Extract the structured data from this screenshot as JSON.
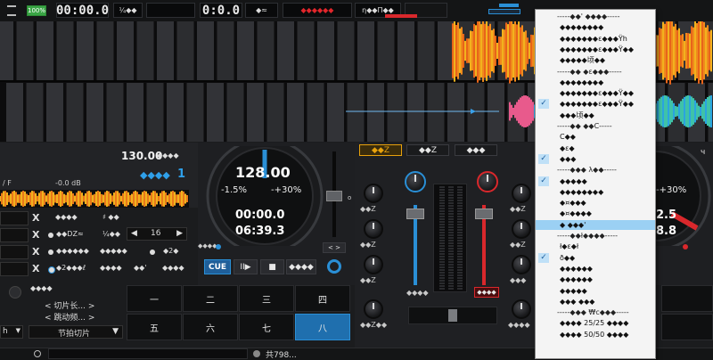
{
  "topbar": {
    "percent_badge": "100%",
    "left_time": "00:00.0",
    "small_btn": "¼◆◆",
    "center_time": "0:0.0",
    "mode_btn": "◆≈",
    "red_btn": "◆◆◆◆◆◆",
    "eta_btn": "η◆◆Π◆◆"
  },
  "deck_left": {
    "bpm": "130.00",
    "bpm_suffix": "◆◆◆◆",
    "sync_label": "◆◆◆◆",
    "sync_num": "1",
    "gain_left": "/ F",
    "gain_value": "-0.0 dB"
  },
  "jog_left": {
    "bpm": "128.00",
    "pitch_minus": "-1.5%",
    "pitch_plus": "-+30%",
    "elapsed": "00:00.0",
    "remaining": "06:39.3",
    "dots_label": "◆◆◆◆"
  },
  "transport": {
    "cue": "CUE",
    "play": "II▶",
    "stop": "■",
    "sync": "◆◆◆◆"
  },
  "loops": {
    "x_label": "X",
    "r1": "◆◆◆◆",
    "r1b": "♯ ◆◆",
    "r2": "◆◆DZ≈",
    "r2b": "¼◆◆",
    "loop_len": "16",
    "r3": "◆◆◆◆◆◆",
    "r3b": "◆◆◆◆◆",
    "r3c": "◆2◆",
    "r4": "◆2◆◆◆ℓ",
    "r4b": "◆◆◆◆",
    "r4c": "◆◆'",
    "r4d": "◆◆◆◆"
  },
  "slicer": {
    "header": "◆◆◆◆",
    "line1": "< 切片长...  >",
    "line2": "< 跳动频...  >",
    "dropdown": "节拍切片",
    "left_dd": "h",
    "pads": [
      "一",
      "二",
      "三",
      "四",
      "五",
      "六",
      "七",
      "八"
    ]
  },
  "mixer": {
    "tab1": "◆◆Z",
    "tab2": "◆◆Z",
    "tab3": "◆◆◆",
    "knob_labels": [
      "◆◆Z",
      "◆◆Z",
      "◆◆Z",
      "◆◆◆"
    ],
    "bottom_left": "◆◆◆◆",
    "bottom_right": "◆◆◆◆",
    "cross_left": "◆◆Z◆◆",
    "cross_right": "◆◆◆◆"
  },
  "jog_right": {
    "pitch_plus": "-+30%",
    "val1": "2.5",
    "val2": "8.8",
    "corner": "ч"
  },
  "footer": {
    "count": "共798..."
  },
  "context_menu": {
    "items": [
      {
        "text": "-----◆◆' ◆◆◆◆-----",
        "sep": true
      },
      {
        "text": "◆◆◆◆◆◆◆◆"
      },
      {
        "text": "◆◆◆◆◆◆◆ε◆◆◆Ÿh"
      },
      {
        "text": "◆◆◆◆◆◆◆ε◆◆◆Ÿ◆◆"
      },
      {
        "text": "◆◆◆◆◆顷◆◆"
      },
      {
        "text": "-----◆◆ ◆ε◆◆◆-----",
        "sep": true
      },
      {
        "text": "◆◆◆◆◆◆◆◆"
      },
      {
        "text": "◆◆◆◆◆◆◆ε◆◆◆Ÿ◆◆"
      },
      {
        "text": "◆◆◆◆◆◆◆ε◆◆◆Ÿ◆◆",
        "checked": true
      },
      {
        "text": "◆◆◆顷◆◆"
      },
      {
        "text": "-----◆◆ ◆◆C-----",
        "sep": true
      },
      {
        "text": "C◆◆"
      },
      {
        "text": "◆ε◆"
      },
      {
        "text": "◆◆◆",
        "checked": true
      },
      {
        "text": "-----◆◆◆ λ◆◆-----",
        "sep": true
      },
      {
        "text": "◆◆◆◆◆",
        "checked": true
      },
      {
        "text": "◆◆◆◆◆◆◆◆"
      },
      {
        "text": "◆¤◆◆◆"
      },
      {
        "text": "◆¤◆◆◆◆"
      },
      {
        "text": "◆ ◆◆◆'",
        "highlight": true
      },
      {
        "text": "-----◆◆ł◆◆◆◆-----",
        "sep": true
      },
      {
        "text": "ł◆ε◆ł"
      },
      {
        "text": "ð◆◆",
        "checked": true
      },
      {
        "text": "◆◆◆◆◆◆"
      },
      {
        "text": "◆◆◆◆◆◆"
      },
      {
        "text": "◆◆◆◆◆"
      },
      {
        "text": "◆◆◆ ◆◆◆"
      },
      {
        "text": "-----◆◆◆ ₩c◆◆◆-----",
        "sep": true
      },
      {
        "text": "◆◆◆◆ 25/25 ◆◆◆◆"
      },
      {
        "text": "◆◆◆◆ 50/50 ◆◆◆◆"
      }
    ]
  },
  "colors": {
    "accent_blue": "#2a8fd6",
    "accent_red": "#e2262b",
    "pad_active": "#1f6fae",
    "deck_tab_active": "#e8a20c"
  }
}
